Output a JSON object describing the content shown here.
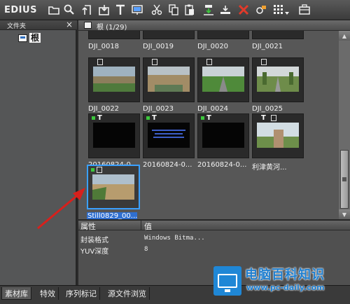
{
  "app": {
    "title": "EDIUS"
  },
  "toolbar": {
    "icons": [
      "folder-icon",
      "search-icon",
      "up-folder-icon",
      "import-icon",
      "title-icon",
      "monitor-icon",
      "scissors-icon",
      "copy-icon",
      "paste-icon",
      "add-to-timeline-icon",
      "insert-icon",
      "delete-icon",
      "properties-icon",
      "view-mode-icon",
      "bin-options-icon"
    ]
  },
  "folder_panel": {
    "header": "文件夹",
    "close": "×",
    "root_label": "根"
  },
  "bin": {
    "path": "根 (1/29)",
    "clips": [
      {
        "label": "DJI_0018",
        "kind": "video"
      },
      {
        "label": "DJI_0019",
        "kind": "video"
      },
      {
        "label": "DJI_0020",
        "kind": "video"
      },
      {
        "label": "DJI_0021",
        "kind": "video"
      },
      {
        "label": "DJI_0022",
        "kind": "video"
      },
      {
        "label": "DJI_0023",
        "kind": "video"
      },
      {
        "label": "DJI_0024",
        "kind": "video"
      },
      {
        "label": "DJI_0025",
        "kind": "video"
      },
      {
        "label": "20160824-0...",
        "kind": "title"
      },
      {
        "label": "20160824-0...",
        "kind": "title"
      },
      {
        "label": "20160824-0...",
        "kind": "title"
      },
      {
        "label": "利津黄河...",
        "kind": "title"
      },
      {
        "label": "Still0829_00...",
        "kind": "still",
        "selected": true
      }
    ]
  },
  "properties": {
    "col_name": "属性",
    "col_value": "值",
    "rows": [
      {
        "name": "封装格式",
        "value": "Windows Bitma..."
      },
      {
        "name": "YUV深度",
        "value": "8"
      }
    ]
  },
  "tabs": [
    "素材库",
    "特效",
    "序列标记",
    "源文件浏览"
  ],
  "watermark": {
    "title": "电脑百科知识",
    "url": "www.pc-daily.com"
  },
  "colors": {
    "selection": "#2f6fd0",
    "accent": "#1f7fd0",
    "delete": "#e23a2a",
    "arrow": "#d8201c"
  }
}
